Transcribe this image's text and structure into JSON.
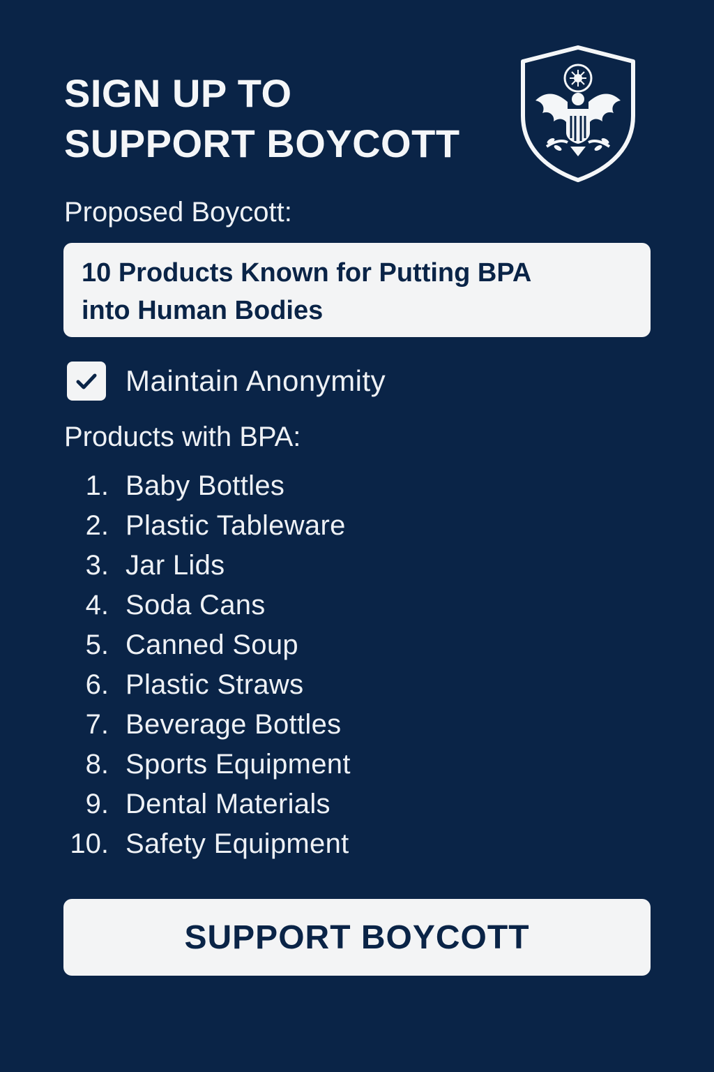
{
  "header": {
    "title_line1": "SIGN UP TO",
    "title_line2": "SUPPORT BOYCOTT",
    "emblem_icon": "eagle-shield-emblem"
  },
  "form": {
    "proposed_label": "Proposed Boycott:",
    "proposed_line1": "10 Products Known for Putting BPA",
    "proposed_line2": "into Human Bodies",
    "anonymity_label": "Maintain Anonymity",
    "anonymity_checked": true,
    "products_label": "Products with BPA:",
    "products": [
      {
        "num": "1.",
        "name": "Baby Bottles"
      },
      {
        "num": "2.",
        "name": "Plastic Tableware"
      },
      {
        "num": "3.",
        "name": "Jar Lids"
      },
      {
        "num": "4.",
        "name": "Soda Cans"
      },
      {
        "num": "5.",
        "name": "Canned Soup"
      },
      {
        "num": "6.",
        "name": "Plastic Straws"
      },
      {
        "num": "7.",
        "name": "Beverage Bottles"
      },
      {
        "num": "8.",
        "name": "Sports Equipment"
      },
      {
        "num": "9.",
        "name": "Dental Materials"
      },
      {
        "num": "10.",
        "name": "Safety Equipment"
      }
    ],
    "submit_label": "SUPPORT BOYCOTT"
  },
  "colors": {
    "background": "#0a2447",
    "panel": "#f3f4f5",
    "text_light": "#eef1f5",
    "text_dark": "#0a2447"
  }
}
